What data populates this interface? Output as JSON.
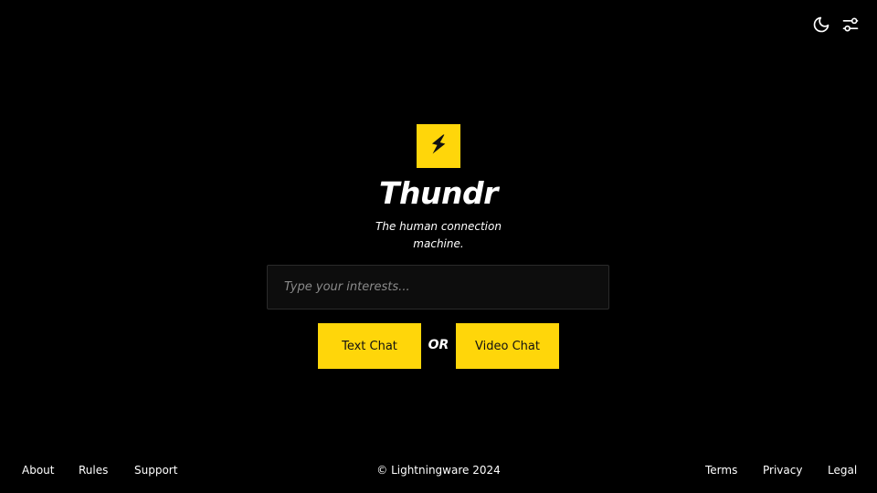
{
  "header": {
    "icons": [
      "moon-icon",
      "sliders-icon"
    ]
  },
  "brand": {
    "name": "Thundr",
    "tagline_line1": "The human connection",
    "tagline_line2": "machine.",
    "logo_icon": "lightning-bolt-icon",
    "accent_color": "#ffd60a"
  },
  "search": {
    "placeholder": "Type your interests...",
    "value": ""
  },
  "actions": {
    "text_chat_label": "Text Chat",
    "separator": "OR",
    "video_chat_label": "Video Chat"
  },
  "footer": {
    "left_links": [
      "About",
      "Rules",
      "Support"
    ],
    "copyright": "© Lightningware 2024",
    "right_links": [
      "Terms",
      "Privacy",
      "Legal"
    ]
  }
}
